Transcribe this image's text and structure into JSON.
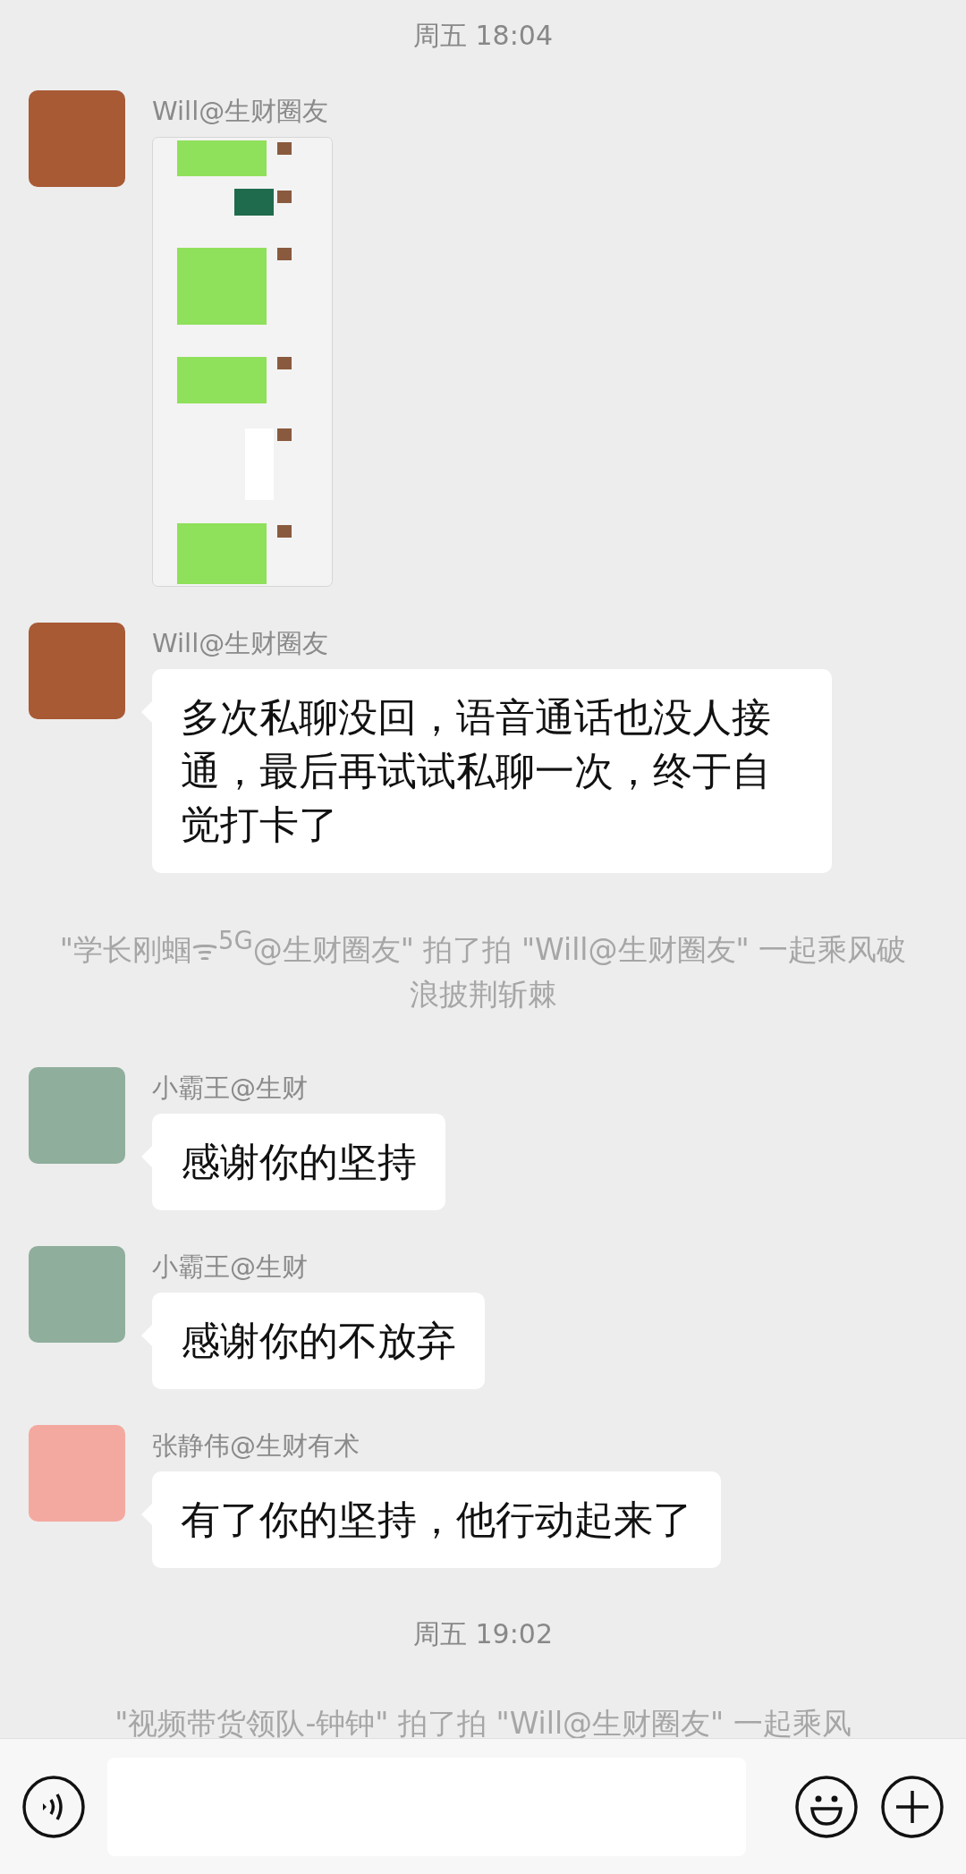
{
  "messages": [
    {
      "kind": "time",
      "text": "周五 18:04"
    },
    {
      "kind": "image",
      "sender": "Will@生财圈友",
      "color": "#a85a35"
    },
    {
      "kind": "text",
      "sender": "Will@生财圈友",
      "color": "#a85a35",
      "text": "多次私聊没回，语音通话也没人接通，最后再试试私聊一次，终于自觉打卡了"
    },
    {
      "kind": "system",
      "text": "\"学长刚蝈ᯤ$^{5G}$@生财圈友\" 拍了拍 \"Will@生财圈友\" 一起乘风破浪披荆斩棘"
    },
    {
      "kind": "text",
      "sender": "小霸王@生财",
      "color": "#8fae9c",
      "text": "感谢你的坚持"
    },
    {
      "kind": "text",
      "sender": "小霸王@生财",
      "color": "#8fae9c",
      "text": "感谢你的不放弃"
    },
    {
      "kind": "text",
      "sender": "张静伟@生财有术",
      "color": "#f4a9a0",
      "text": "有了你的坚持，他行动起来了"
    },
    {
      "kind": "time",
      "text": "周五 19:02"
    },
    {
      "kind": "system",
      "text": "\"视频带货领队-钟钟\" 拍了拍 \"Will@生财圈友\" 一起乘风"
    }
  ]
}
